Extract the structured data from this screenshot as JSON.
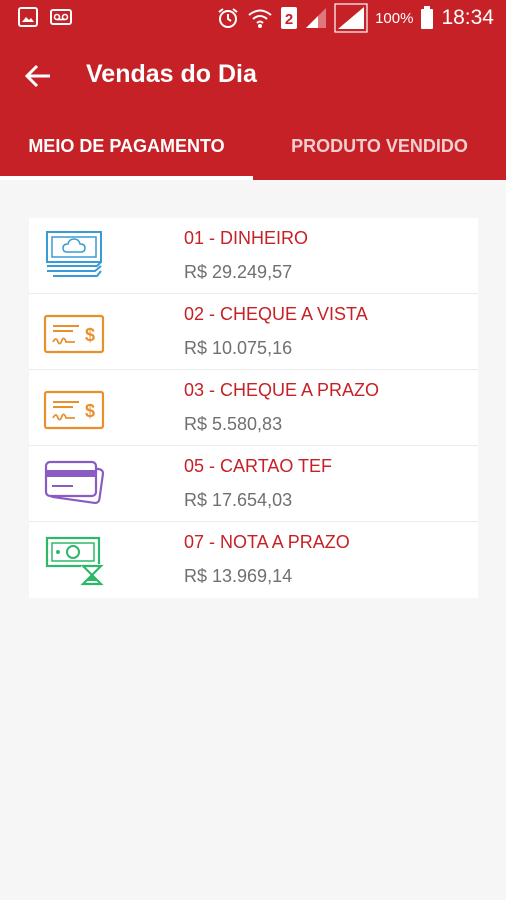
{
  "status_bar": {
    "battery": "100%",
    "time": "18:34"
  },
  "toolbar": {
    "title": "Vendas do Dia"
  },
  "tabs": [
    {
      "label": "MEIO DE PAGAMENTO",
      "active": true
    },
    {
      "label": "PRODUTO VENDIDO",
      "active": false
    }
  ],
  "payments": [
    {
      "name": "01 - DINHEIRO",
      "value": "R$ 29.249,57",
      "icon": "cash-icon",
      "color": "#3a9bd5"
    },
    {
      "name": "02 - CHEQUE A VISTA",
      "value": "R$ 10.075,16",
      "icon": "check-icon",
      "color": "#e8902c"
    },
    {
      "name": "03 - CHEQUE A PRAZO",
      "value": "R$ 5.580,83",
      "icon": "check-icon",
      "color": "#e8902c"
    },
    {
      "name": "05 - CARTAO TEF",
      "value": "R$ 17.654,03",
      "icon": "credit-card-icon",
      "color": "#8a5bc2"
    },
    {
      "name": "07 - NOTA A PRAZO",
      "value": "R$ 13.969,14",
      "icon": "deferred-bill-icon",
      "color": "#2eb86a"
    }
  ],
  "colors": {
    "primary": "#c62127",
    "background": "#f6f6f6"
  }
}
